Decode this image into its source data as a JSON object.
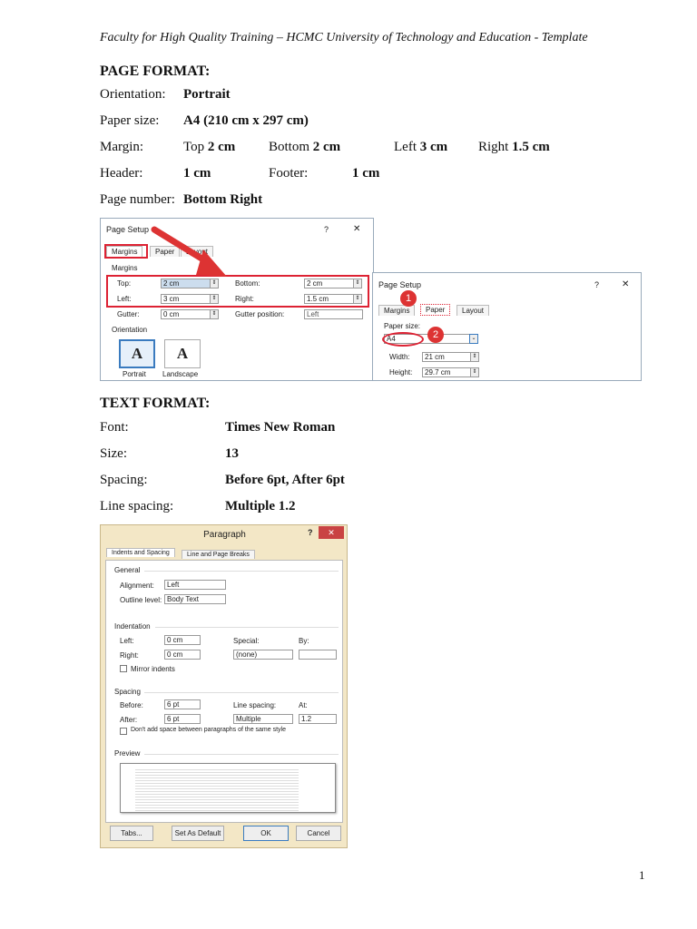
{
  "header": "Faculty for High Quality Training – HCMC University of Technology and Education - Template",
  "page_format": {
    "title": "PAGE FORMAT:",
    "orientation": {
      "label": "Orientation:",
      "value": "Portrait"
    },
    "paper_size": {
      "label": "Paper size:",
      "value": "A4 (210 cm x 297 cm)"
    },
    "margin": {
      "label": "Margin:",
      "top_label": "Top",
      "top": "2 cm",
      "bottom_label": "Bottom",
      "bottom": "2 cm",
      "left_label": "Left",
      "left": "3 cm",
      "right_label": "Right",
      "right": "1.5 cm"
    },
    "header": {
      "label": "Header:",
      "value": "1 cm",
      "footer_label": "Footer:",
      "footer_value": "1 cm"
    },
    "page_number": {
      "label": "Page number:",
      "value": "Bottom Right"
    }
  },
  "page_setup_margins": {
    "title": "Page Setup",
    "help": "?",
    "close": "✕",
    "tabs": [
      "Margins",
      "Paper",
      "Layout"
    ],
    "group": "Margins",
    "top_label": "Top:",
    "top": "2 cm",
    "bottom_label": "Bottom:",
    "bottom": "2 cm",
    "left_label": "Left:",
    "left": "3 cm",
    "right_label": "Right:",
    "right": "1.5 cm",
    "gutter_label": "Gutter:",
    "gutter": "0 cm",
    "gutter_pos_label": "Gutter position:",
    "gutter_pos": "Left",
    "orientation_group": "Orientation",
    "portrait": "Portrait",
    "landscape": "Landscape",
    "icon_letter": "A"
  },
  "page_setup_paper": {
    "title": "Page Setup",
    "help": "?",
    "close": "✕",
    "tabs": [
      "Margins",
      "Paper",
      "Layout"
    ],
    "badge1": "1",
    "badge2": "2",
    "size_label": "Paper size:",
    "size": "A4",
    "width_label": "Width:",
    "width": "21 cm",
    "height_label": "Height:",
    "height": "29.7 cm"
  },
  "text_format": {
    "title": "TEXT FORMAT:",
    "font": {
      "label": "Font:",
      "value": "Times New Roman"
    },
    "size": {
      "label": "Size:",
      "value": "13"
    },
    "spacing": {
      "label": "Spacing:",
      "value": "Before 6pt, After 6pt"
    },
    "line_spacing": {
      "label": "Line spacing:",
      "value": "Multiple 1.2"
    }
  },
  "paragraph": {
    "title": "Paragraph",
    "help": "?",
    "close": "✕",
    "tabs": [
      "Indents and Spacing",
      "Line and Page Breaks"
    ],
    "general": "General",
    "alignment_label": "Alignment:",
    "alignment": "Left",
    "outline_label": "Outline level:",
    "outline": "Body Text",
    "indentation": "Indentation",
    "left_label": "Left:",
    "left": "0 cm",
    "right_label": "Right:",
    "right": "0 cm",
    "special_label": "Special:",
    "special": "(none)",
    "by_label": "By:",
    "mirror": "Mirror indents",
    "spacing": "Spacing",
    "before_label": "Before:",
    "before": "6 pt",
    "after_label": "After:",
    "after": "6 pt",
    "line_label": "Line spacing:",
    "line": "Multiple",
    "at_label": "At:",
    "at": "1.2",
    "dont_add": "Don't add space between paragraphs of the same style",
    "preview": "Preview",
    "tabs_btn": "Tabs...",
    "default_btn": "Set As Default",
    "ok": "OK",
    "cancel": "Cancel"
  },
  "page_number": "1"
}
